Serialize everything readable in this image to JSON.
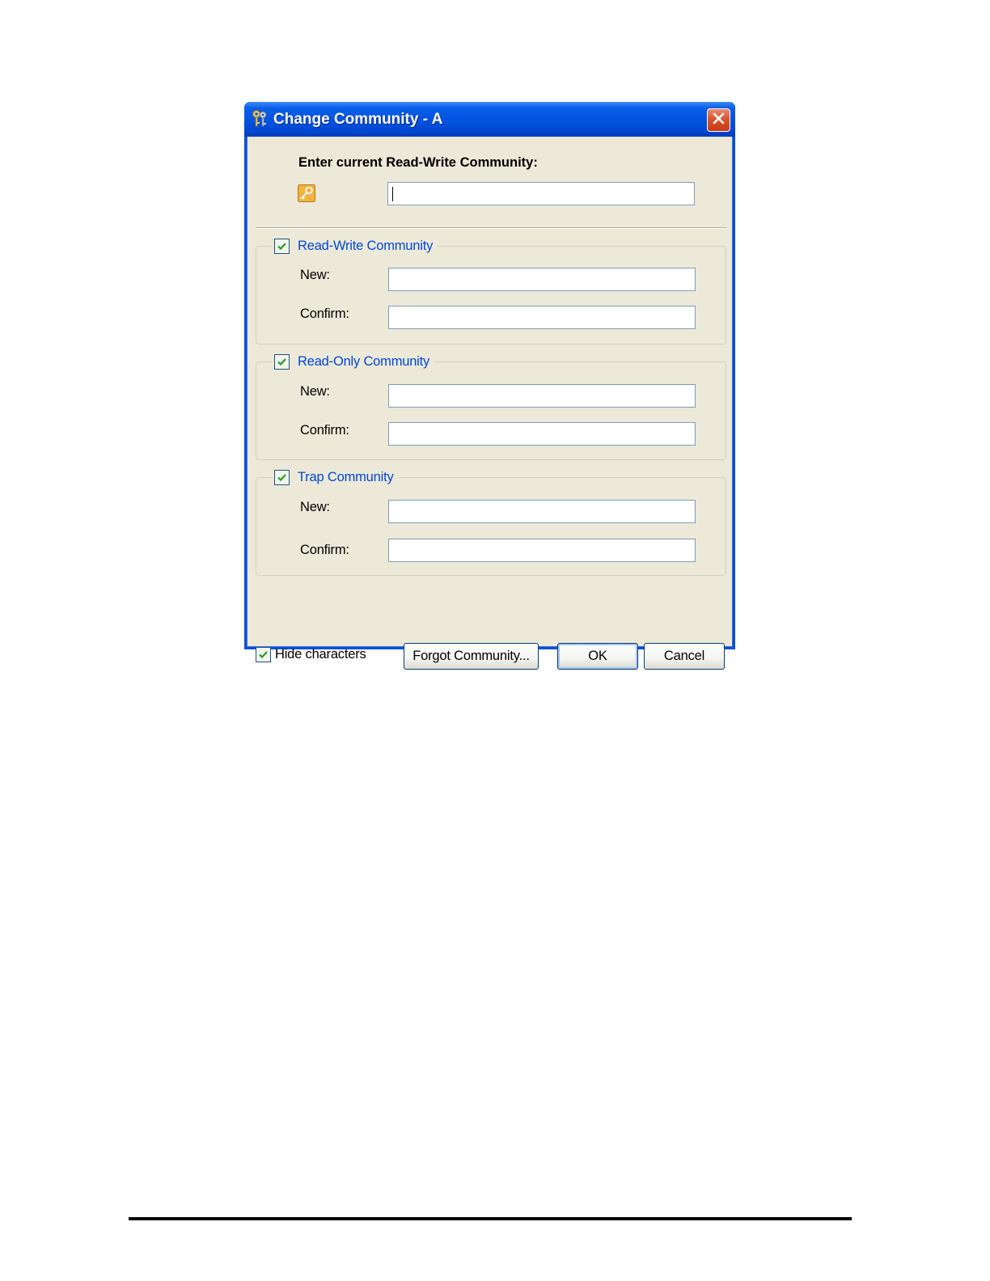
{
  "dialog": {
    "title": "Change Community - A",
    "prompt": "Enter current Read-Write Community:",
    "current_value": "",
    "groups": [
      {
        "label": "Read-Write Community",
        "checked": true,
        "new_label": "New:",
        "confirm_label": "Confirm:",
        "new_value": "",
        "confirm_value": ""
      },
      {
        "label": "Read-Only Community",
        "checked": true,
        "new_label": "New:",
        "confirm_label": "Confirm:",
        "new_value": "",
        "confirm_value": ""
      },
      {
        "label": "Trap Community",
        "checked": true,
        "new_label": "New:",
        "confirm_label": "Confirm:",
        "new_value": "",
        "confirm_value": ""
      }
    ],
    "hide_characters": {
      "label": "Hide characters",
      "checked": true
    },
    "buttons": {
      "forgot": "Forgot Community...",
      "ok": "OK",
      "cancel": "Cancel"
    }
  },
  "icons": {
    "app": "keys-icon",
    "close": "close-icon",
    "key": "key-icon",
    "check": "checkmark-icon"
  },
  "colors": {
    "titlebar": "#0053e0",
    "window_face": "#ece9d8",
    "group_label": "#0046d5",
    "close_button": "#d9552f"
  }
}
